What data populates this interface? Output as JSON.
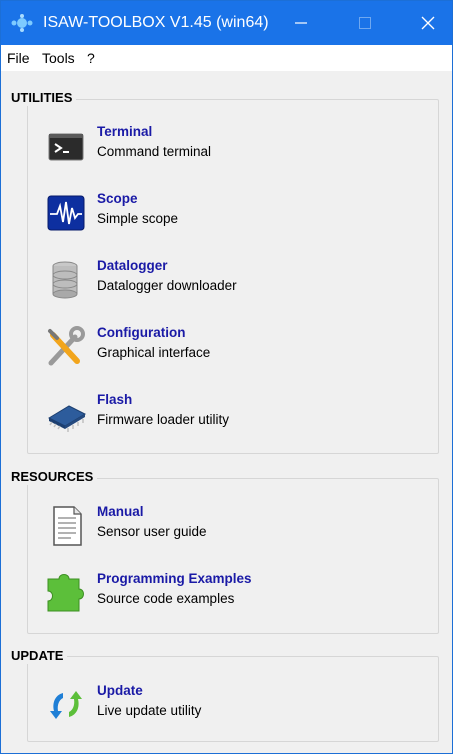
{
  "window": {
    "title": "ISAW-TOOLBOX V1.45 (win64)",
    "title_color": "#1a73e8"
  },
  "menu": {
    "items": [
      "File",
      "Tools",
      "?"
    ]
  },
  "sections": {
    "utilities": {
      "title": "UTILITIES",
      "items": [
        {
          "label": "Terminal",
          "desc": "Command terminal",
          "icon": "terminal-icon"
        },
        {
          "label": "Scope",
          "desc": "Simple scope",
          "icon": "scope-icon"
        },
        {
          "label": "Datalogger",
          "desc": "Datalogger downloader",
          "icon": "database-icon"
        },
        {
          "label": "Configuration",
          "desc": "Graphical interface",
          "icon": "tools-icon"
        },
        {
          "label": "Flash",
          "desc": "Firmware loader utility",
          "icon": "chip-icon"
        }
      ]
    },
    "resources": {
      "title": "RESOURCES",
      "items": [
        {
          "label": "Manual",
          "desc": "Sensor user guide",
          "icon": "document-icon"
        },
        {
          "label": "Programming Examples",
          "desc": "Source code examples",
          "icon": "puzzle-icon"
        }
      ]
    },
    "update": {
      "title": "UPDATE",
      "items": [
        {
          "label": "Update",
          "desc": "Live update utility",
          "icon": "refresh-icon"
        }
      ]
    }
  },
  "colors": {
    "link": "#1a1aa6",
    "titlebar": "#1a73e8",
    "panel": "#f0f0f0"
  }
}
